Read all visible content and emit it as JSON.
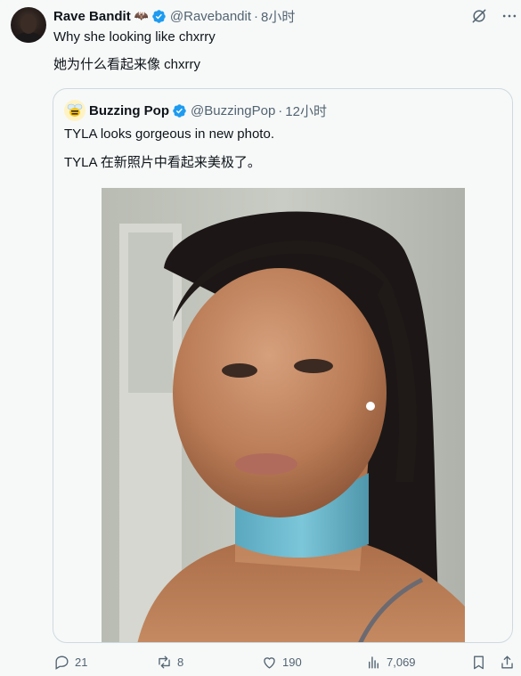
{
  "tweet": {
    "author_name": "Rave Bandit",
    "author_emoji": "🦇",
    "handle": "@Ravebandit",
    "separator": "·",
    "time": "8小时",
    "text_line1": "Why she looking like chxrry",
    "text_line2": "她为什么看起来像 chxrry"
  },
  "quoted": {
    "author_name": "Buzzing Pop",
    "handle": "@BuzzingPop",
    "separator": "·",
    "time": "12小时",
    "text_line1": "TYLA looks gorgeous in new photo.",
    "text_line2": "TYLA 在新照片中看起来美极了。"
  },
  "actions": {
    "replies": "21",
    "reposts": "8",
    "likes": "190",
    "views": "7,069"
  },
  "colors": {
    "verified_blue": "#1d9bf0",
    "muted_text": "#536471",
    "border": "#cfd9de",
    "background": "#f7f9f9"
  },
  "icons": [
    "grok-icon",
    "more-icon",
    "verified-icon",
    "reply-icon",
    "repost-icon",
    "like-icon",
    "views-icon",
    "bookmark-icon",
    "share-icon"
  ]
}
